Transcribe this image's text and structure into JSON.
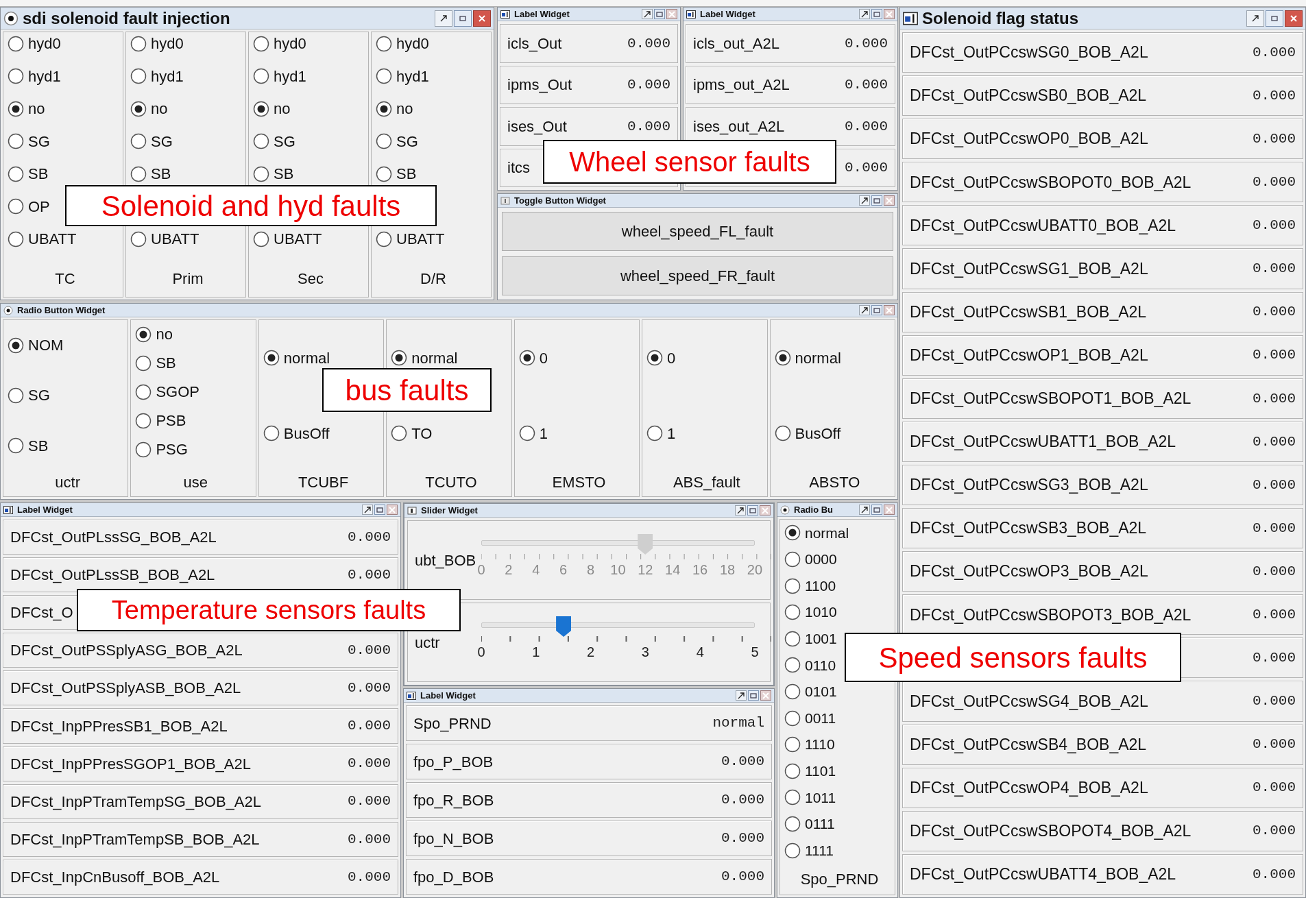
{
  "solenoid_window": {
    "title": "sdi solenoid fault injection",
    "groups": [
      {
        "caption": "TC",
        "options": [
          {
            "label": "hyd0",
            "selected": false
          },
          {
            "label": "hyd1",
            "selected": false
          },
          {
            "label": "no",
            "selected": true
          },
          {
            "label": "SG",
            "selected": false
          },
          {
            "label": "SB",
            "selected": false
          },
          {
            "label": "OP",
            "selected": false
          },
          {
            "label": "UBATT",
            "selected": false
          }
        ]
      },
      {
        "caption": "Prim",
        "options": [
          {
            "label": "hyd0",
            "selected": false
          },
          {
            "label": "hyd1",
            "selected": false
          },
          {
            "label": "no",
            "selected": true
          },
          {
            "label": "SG",
            "selected": false
          },
          {
            "label": "SB",
            "selected": false
          },
          {
            "label": "UBATT",
            "selected": false
          }
        ]
      },
      {
        "caption": "Sec",
        "options": [
          {
            "label": "hyd0",
            "selected": false
          },
          {
            "label": "hyd1",
            "selected": false
          },
          {
            "label": "no",
            "selected": true
          },
          {
            "label": "SG",
            "selected": false
          },
          {
            "label": "SB",
            "selected": false
          },
          {
            "label": "UBATT",
            "selected": false
          }
        ]
      },
      {
        "caption": "D/R",
        "options": [
          {
            "label": "hyd0",
            "selected": false
          },
          {
            "label": "hyd1",
            "selected": false
          },
          {
            "label": "no",
            "selected": true
          },
          {
            "label": "SG",
            "selected": false
          },
          {
            "label": "SB",
            "selected": false
          },
          {
            "label": "UBATT",
            "selected": false
          }
        ]
      }
    ]
  },
  "wheel_label_widgets": [
    {
      "title": "Label Widget",
      "rows": [
        {
          "name": "icls_Out",
          "value": "0.000"
        },
        {
          "name": "ipms_Out",
          "value": "0.000"
        },
        {
          "name": "ises_Out",
          "value": "0.000"
        },
        {
          "name": "itcs"
        }
      ]
    },
    {
      "title": "Label Widget",
      "rows": [
        {
          "name": "icls_out_A2L",
          "value": "0.000"
        },
        {
          "name": "ipms_out_A2L",
          "value": "0.000"
        },
        {
          "name": "ises_out_A2L",
          "value": "0.000"
        },
        {
          "value": "0.000"
        }
      ]
    }
  ],
  "toggle_widget": {
    "title": "Toggle Button Widget",
    "buttons": [
      "wheel_speed_FL_fault",
      "wheel_speed_FR_fault"
    ]
  },
  "radio_widget": {
    "title": "Radio Button Widget",
    "groups": [
      {
        "caption": "uctr",
        "options": [
          {
            "label": "NOM",
            "selected": true
          },
          {
            "label": "SG",
            "selected": false
          },
          {
            "label": "SB",
            "selected": false
          }
        ]
      },
      {
        "caption": "use",
        "options": [
          {
            "label": "no",
            "selected": true
          },
          {
            "label": "SB",
            "selected": false
          },
          {
            "label": "SGOP",
            "selected": false
          },
          {
            "label": "PSB",
            "selected": false
          },
          {
            "label": "PSG",
            "selected": false
          }
        ]
      },
      {
        "caption": "TCUBF",
        "options": [
          {
            "label": "normal",
            "selected": true
          },
          {
            "label": "BusOff",
            "selected": false
          }
        ]
      },
      {
        "caption": "TCUTO",
        "options": [
          {
            "label": "normal",
            "selected": true
          },
          {
            "label": "TO",
            "selected": false
          }
        ]
      },
      {
        "caption": "EMSTO",
        "options": [
          {
            "label": "0",
            "selected": true
          },
          {
            "label": "1",
            "selected": false
          }
        ]
      },
      {
        "caption": "ABS_fault",
        "options": [
          {
            "label": "0",
            "selected": true
          },
          {
            "label": "1",
            "selected": false
          }
        ]
      },
      {
        "caption": "ABSTO",
        "options": [
          {
            "label": "normal",
            "selected": true
          },
          {
            "label": "BusOff",
            "selected": false
          }
        ]
      }
    ]
  },
  "temperature_widget": {
    "title": "Label Widget",
    "rows": [
      {
        "name": "DFCst_OutPLssSG_BOB_A2L",
        "value": "0.000"
      },
      {
        "name": "DFCst_OutPLssSB_BOB_A2L",
        "value": "0.000"
      },
      {
        "name": "DFCst_O"
      },
      {
        "name": "DFCst_OutPSSplyASG_BOB_A2L",
        "value": "0.000"
      },
      {
        "name": "DFCst_OutPSSplyASB_BOB_A2L",
        "value": "0.000"
      },
      {
        "name": "DFCst_InpPPresSB1_BOB_A2L",
        "value": "0.000"
      },
      {
        "name": "DFCst_InpPPresSGOP1_BOB_A2L",
        "value": "0.000"
      },
      {
        "name": "DFCst_InpPTramTempSG_BOB_A2L",
        "value": "0.000"
      },
      {
        "name": "DFCst_InpPTramTempSB_BOB_A2L",
        "value": "0.000"
      },
      {
        "name": "DFCst_InpCnBusoff_BOB_A2L",
        "value": "0.000"
      }
    ]
  },
  "slider_widget": {
    "title": "Slider Widget",
    "sliders": [
      {
        "label": "ubt_BOB",
        "level": 0.6,
        "disabled": true,
        "ticks": [
          "0",
          "2",
          "4",
          "6",
          "8",
          "10",
          "12",
          "14",
          "16",
          "18",
          "20"
        ]
      },
      {
        "label": "uctr",
        "level": 0.3,
        "disabled": false,
        "ticks": [
          "0",
          "1",
          "2",
          "3",
          "4",
          "5"
        ]
      }
    ]
  },
  "prnd_widget": {
    "title": "Label Widget",
    "rows": [
      {
        "name": "Spo_PRND",
        "value": "normal"
      },
      {
        "name": "fpo_P_BOB",
        "value": "0.000"
      },
      {
        "name": "fpo_R_BOB",
        "value": "0.000"
      },
      {
        "name": "fpo_N_BOB",
        "value": "0.000"
      },
      {
        "name": "fpo_D_BOB",
        "value": "0.000"
      }
    ]
  },
  "prnd_radio": {
    "title": "Radio Bu",
    "caption": "Spo_PRND",
    "options": [
      {
        "label": "normal",
        "selected": true
      },
      {
        "label": "0000",
        "selected": false
      },
      {
        "label": "1100",
        "selected": false
      },
      {
        "label": "1010",
        "selected": false
      },
      {
        "label": "1001",
        "selected": false
      },
      {
        "label": "0110",
        "selected": false
      },
      {
        "label": "0101",
        "selected": false
      },
      {
        "label": "0011",
        "selected": false
      },
      {
        "label": "1110",
        "selected": false
      },
      {
        "label": "1101",
        "selected": false
      },
      {
        "label": "1011",
        "selected": false
      },
      {
        "label": "0111",
        "selected": false
      },
      {
        "label": "1111",
        "selected": false
      }
    ]
  },
  "flag_status": {
    "title": "Solenoid flag status",
    "rows": [
      {
        "name": "DFCst_OutPCcswSG0_BOB_A2L",
        "value": "0.000"
      },
      {
        "name": "DFCst_OutPCcswSB0_BOB_A2L",
        "value": "0.000"
      },
      {
        "name": "DFCst_OutPCcswOP0_BOB_A2L",
        "value": "0.000"
      },
      {
        "name": "DFCst_OutPCcswSBOPOT0_BOB_A2L",
        "value": "0.000"
      },
      {
        "name": "DFCst_OutPCcswUBATT0_BOB_A2L",
        "value": "0.000"
      },
      {
        "name": "DFCst_OutPCcswSG1_BOB_A2L",
        "value": "0.000"
      },
      {
        "name": "DFCst_OutPCcswSB1_BOB_A2L",
        "value": "0.000"
      },
      {
        "name": "DFCst_OutPCcswOP1_BOB_A2L",
        "value": "0.000"
      },
      {
        "name": "DFCst_OutPCcswSBOPOT1_BOB_A2L",
        "value": "0.000"
      },
      {
        "name": "DFCst_OutPCcswUBATT1_BOB_A2L",
        "value": "0.000"
      },
      {
        "name": "DFCst_OutPCcswSG3_BOB_A2L",
        "value": "0.000"
      },
      {
        "name": "DFCst_OutPCcswSB3_BOB_A2L",
        "value": "0.000"
      },
      {
        "name": "DFCst_OutPCcswOP3_BOB_A2L",
        "value": "0.000"
      },
      {
        "name": "DFCst_OutPCcswSBOPOT3_BOB_A2L",
        "value": "0.000"
      },
      {
        "value": "0.000"
      },
      {
        "name": "DFCst_OutPCcswSG4_BOB_A2L",
        "value": "0.000"
      },
      {
        "name": "DFCst_OutPCcswSB4_BOB_A2L",
        "value": "0.000"
      },
      {
        "name": "DFCst_OutPCcswOP4_BOB_A2L",
        "value": "0.000"
      },
      {
        "name": "DFCst_OutPCcswSBOPOT4_BOB_A2L",
        "value": "0.000"
      },
      {
        "name": "DFCst_OutPCcswUBATT4_BOB_A2L",
        "value": "0.000"
      }
    ]
  },
  "callouts": [
    {
      "text": "Solenoid and hyd faults"
    },
    {
      "text": "Wheel sensor faults"
    },
    {
      "text": "bus faults"
    },
    {
      "text": "Temperature sensors faults"
    },
    {
      "text": "Speed sensors faults"
    }
  ]
}
